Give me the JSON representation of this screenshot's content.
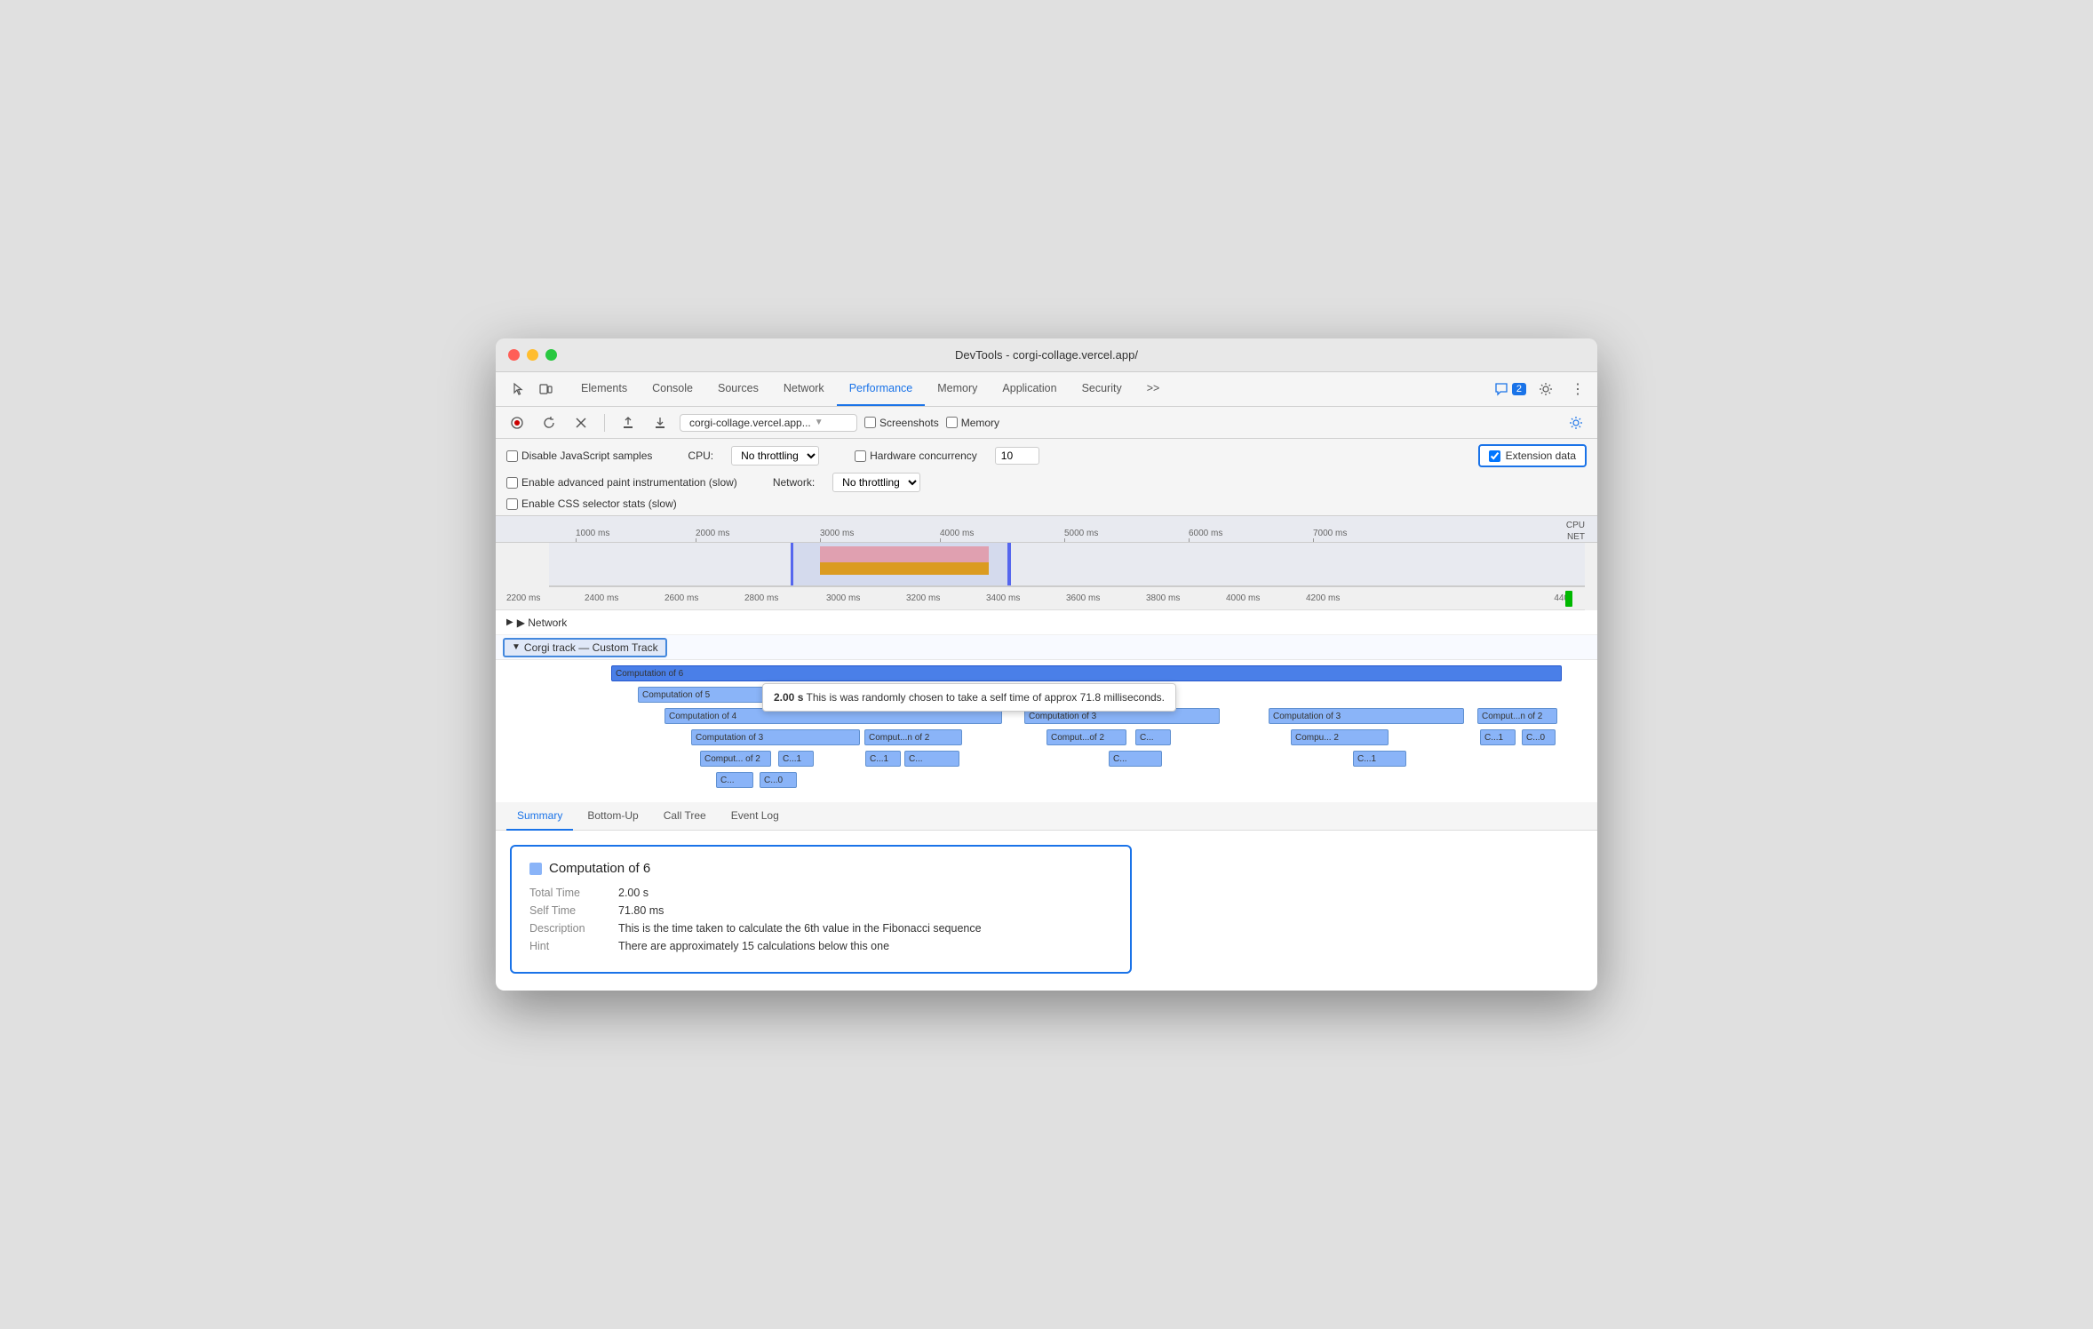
{
  "window": {
    "title": "DevTools - corgi-collage.vercel.app/"
  },
  "titlebar": {
    "close": "●",
    "min": "●",
    "max": "●"
  },
  "nav": {
    "tabs": [
      {
        "label": "Elements",
        "active": false
      },
      {
        "label": "Console",
        "active": false
      },
      {
        "label": "Sources",
        "active": false
      },
      {
        "label": "Network",
        "active": false
      },
      {
        "label": "Performance",
        "active": true
      },
      {
        "label": "Memory",
        "active": false
      },
      {
        "label": "Application",
        "active": false
      },
      {
        "label": "Security",
        "active": false
      }
    ],
    "more_label": ">>",
    "chat_badge": "2"
  },
  "toolbar2": {
    "url_value": "corgi-collage.vercel.app...",
    "screenshots_label": "Screenshots",
    "memory_label": "Memory"
  },
  "options": {
    "disable_js_label": "Disable JavaScript samples",
    "enable_paint_label": "Enable advanced paint instrumentation (slow)",
    "enable_css_label": "Enable CSS selector stats (slow)",
    "cpu_label": "CPU:",
    "cpu_value": "No throttling",
    "network_label": "Network:",
    "network_value": "No throttling",
    "hw_concurrency_label": "Hardware concurrency",
    "hw_concurrency_value": "10",
    "ext_data_label": "Extension data"
  },
  "ruler_overview": {
    "ticks": [
      "1000 ms",
      "2000 ms",
      "3000 ms",
      "4000 ms",
      "5000 ms",
      "6000 ms",
      "7000 ms"
    ]
  },
  "ruler_detail": {
    "ticks": [
      "2200 ms",
      "2400 ms",
      "2600 ms",
      "2800 ms",
      "3000 ms",
      "3200 ms",
      "3400 ms",
      "3600 ms",
      "3800 ms",
      "4000 ms",
      "4200 ms",
      "440"
    ]
  },
  "flame_chart": {
    "network_label": "▶ Network",
    "corgi_track_label": "▼ Corgi track — Custom Track",
    "bars": [
      {
        "label": "Computation of 6",
        "row": 0,
        "selected": true
      },
      {
        "label": "Computation of 5",
        "row": 1
      },
      {
        "label": "Computation of 4",
        "row": 2
      },
      {
        "label": "Computation of 3 (left)",
        "row": 3
      },
      {
        "label": "Comput...n of 2",
        "row": 3
      },
      {
        "label": "Comput...of 2",
        "row": 3
      },
      {
        "label": "C...",
        "row": 3
      },
      {
        "label": "Computation of 3 (right)",
        "row": 2
      },
      {
        "label": "Computation of 3 (far right)",
        "row": 2
      },
      {
        "label": "Comput...n of 2",
        "row": 2
      }
    ]
  },
  "tooltip": {
    "time": "2.00 s",
    "message": "This is was randomly chosen to take a self time of approx 71.8 milliseconds."
  },
  "bottom_tabs": [
    {
      "label": "Summary",
      "active": true
    },
    {
      "label": "Bottom-Up",
      "active": false
    },
    {
      "label": "Call Tree",
      "active": false
    },
    {
      "label": "Event Log",
      "active": false
    }
  ],
  "summary": {
    "title": "Computation of 6",
    "icon_color": "#8ab4f8",
    "rows": [
      {
        "key": "Total Time",
        "value": "2.00 s"
      },
      {
        "key": "Self Time",
        "value": "71.80 ms"
      },
      {
        "key": "Description",
        "value": "This is the time taken to calculate the 6th value in the Fibonacci sequence"
      },
      {
        "key": "Hint",
        "value": "There are approximately 15 calculations below this one"
      }
    ]
  }
}
